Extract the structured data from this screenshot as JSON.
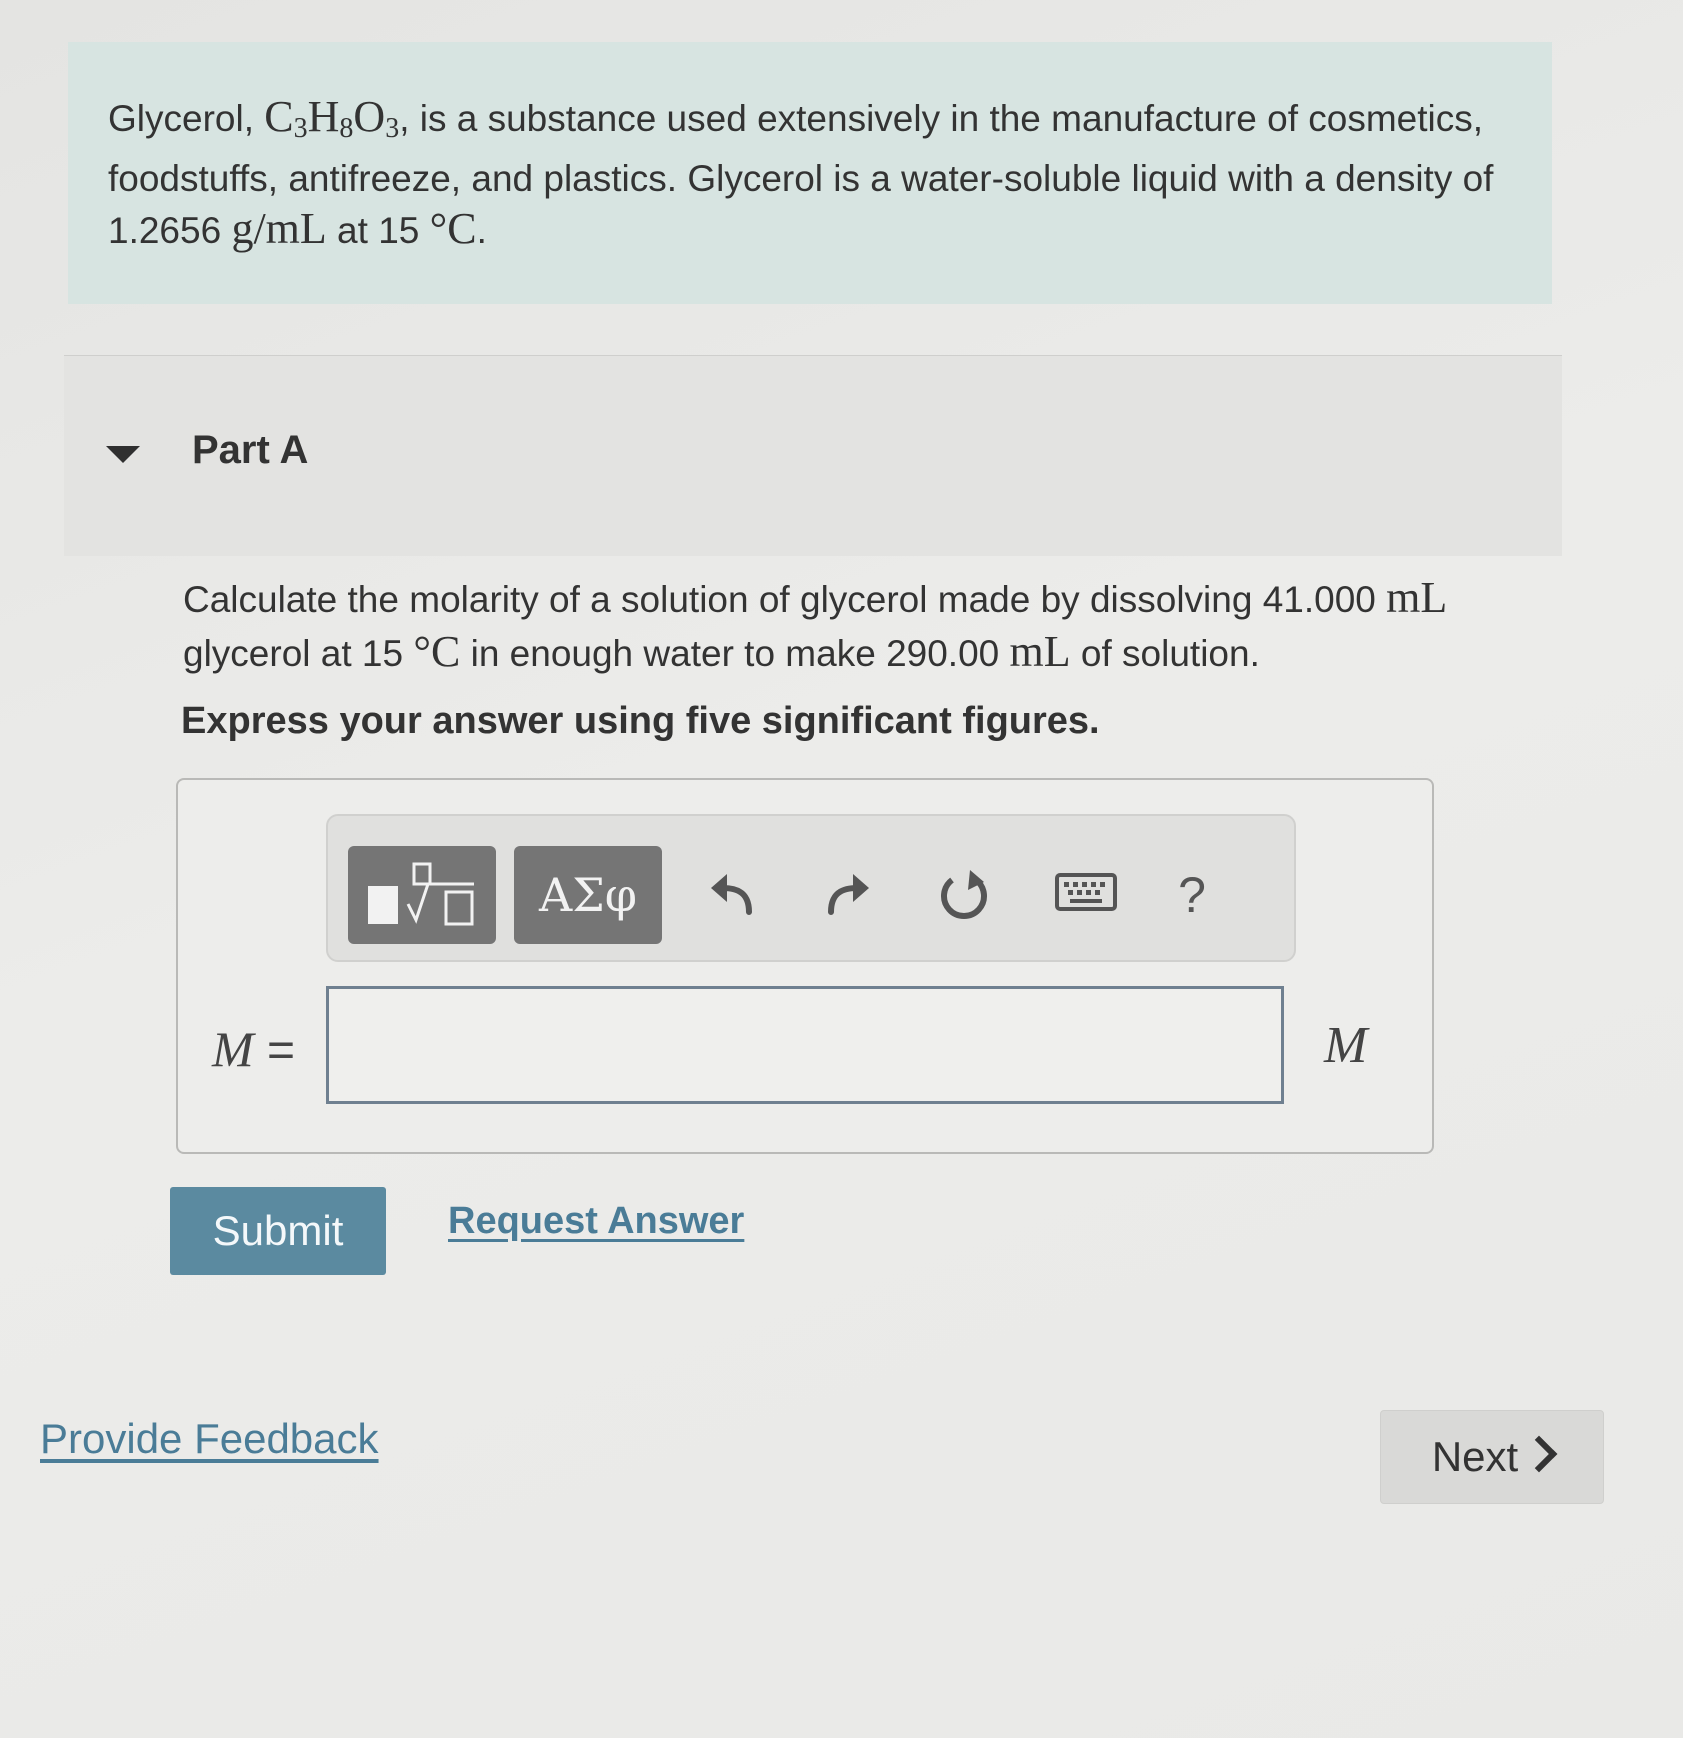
{
  "intro": {
    "line1_a": "Glycerol, ",
    "formula_c": "C",
    "formula_c_sub": "3",
    "formula_h": "H",
    "formula_h_sub": "8",
    "formula_o": "O",
    "formula_o_sub": "3",
    "line1_b": ", is a substance used extensively in the manufacture of cosmetics, foodstuffs, antifreeze, and plastics. Glycerol is a water-soluble liquid with a density of 1.2656 ",
    "density_unit": "g/mL",
    "line1_c": " at 15 ",
    "temp_unit": "°C",
    "line1_d": "."
  },
  "part": {
    "title": "Part A"
  },
  "question": {
    "text_a": "Calculate the molarity of a solution of glycerol made by dissolving 41.000 ",
    "unit_ml_1": "mL",
    "text_b": " glycerol at 15 ",
    "unit_c": "°C",
    "text_c": " in enough water to make 290.00 ",
    "unit_ml_2": "mL",
    "text_d": " of solution.",
    "instruction": "Express your answer using five significant figures."
  },
  "toolbar": {
    "greek_label": "ΑΣφ",
    "help_label": "?"
  },
  "answer": {
    "variable": "M",
    "equals": " =",
    "value": "",
    "unit": "M"
  },
  "actions": {
    "submit_label": "Submit",
    "request_answer_label": "Request Answer",
    "feedback_label": "Provide Feedback",
    "next_label": "Next"
  }
}
